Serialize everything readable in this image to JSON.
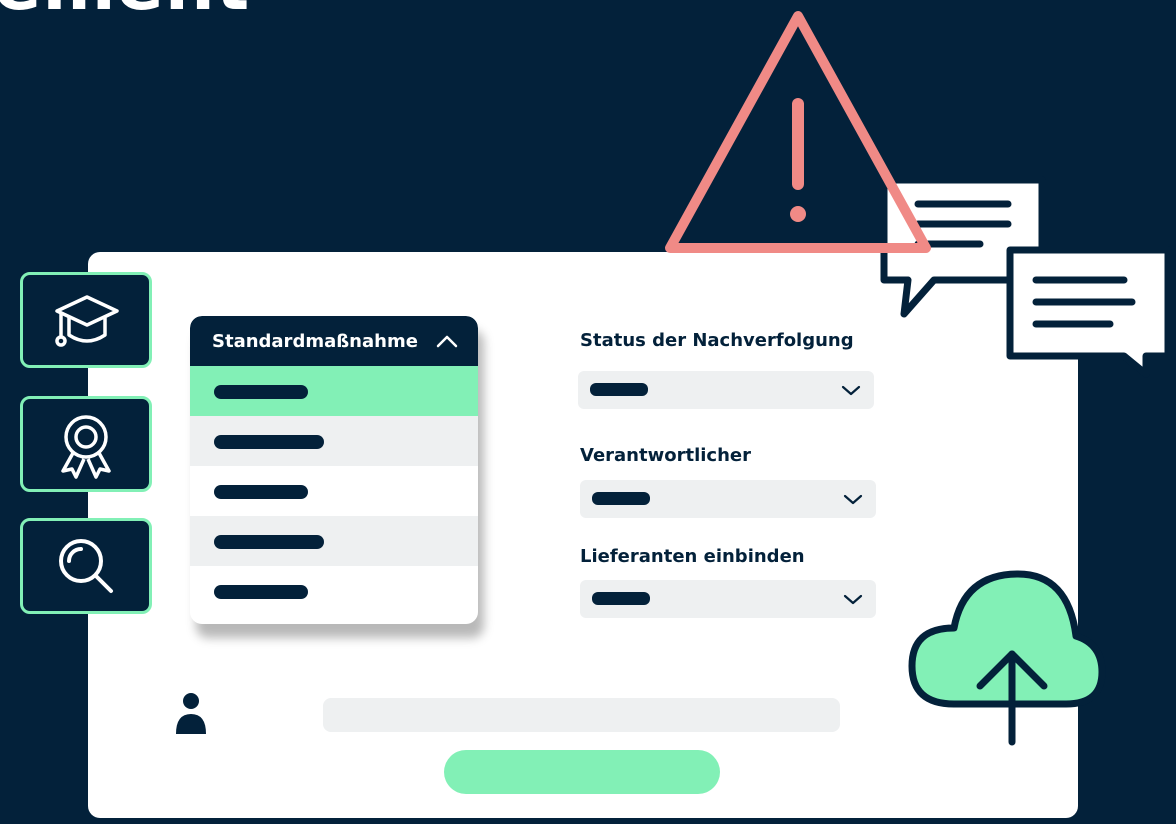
{
  "hero": {
    "title": "ement"
  },
  "dropdown": {
    "header_label": "Standardmaßnahme",
    "options_count_visible": 5
  },
  "fields": {
    "status_label": "Status der Nachverfolgung",
    "responsible_label": "Verantwortlicher",
    "suppliers_label": "Lieferanten einbinden"
  },
  "side_icons": [
    "graduation-cap-icon",
    "award-rosette-icon",
    "search-icon"
  ],
  "decorations": [
    "warning-triangle-icon",
    "chat-bubble-icon",
    "chat-bubble-icon",
    "cloud-upload-icon",
    "user-icon"
  ],
  "colors": {
    "background": "#03213a",
    "accent": "#82f0b6",
    "warning": "#f08a86",
    "panel": "#ffffff",
    "muted": "#eef0f1"
  }
}
